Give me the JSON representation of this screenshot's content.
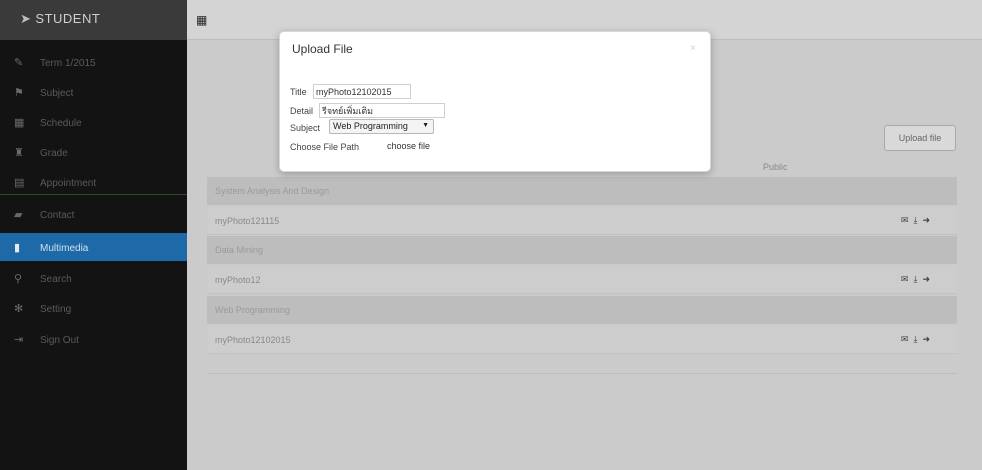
{
  "header": {
    "brand": "STUDENT",
    "brand_icon": "send-icon",
    "grid_icon": "grid-icon"
  },
  "sidebar": {
    "items": [
      {
        "label": "Term 1/2015",
        "icon": "edit-icon",
        "glyph": "✎"
      },
      {
        "label": "Subject",
        "icon": "flag-icon",
        "glyph": "⚑"
      },
      {
        "label": "Schedule",
        "icon": "calendar-icon",
        "glyph": "▦"
      },
      {
        "label": "Grade",
        "icon": "graduation-cap-icon",
        "glyph": "♜"
      },
      {
        "label": "Appointment",
        "icon": "list-icon",
        "glyph": "▤"
      },
      {
        "label": "Contact",
        "icon": "book-icon",
        "glyph": "▰"
      },
      {
        "label": "Multimedia",
        "icon": "file-icon",
        "glyph": "▮"
      },
      {
        "label": "Search",
        "icon": "search-icon",
        "glyph": "⚲"
      },
      {
        "label": "Setting",
        "icon": "gear-icon",
        "glyph": "✻"
      },
      {
        "label": "Sign Out",
        "icon": "sign-out-icon",
        "glyph": "⇥"
      }
    ],
    "active_index": 6,
    "active_color": "#1e6aa8"
  },
  "main": {
    "upload_button": "Upload file",
    "public_column": "Public",
    "rows": [
      {
        "type": "group",
        "label": "System Analysis And Design"
      },
      {
        "type": "item",
        "label": "myPhoto121115"
      },
      {
        "type": "group",
        "label": "Data Mining"
      },
      {
        "type": "item",
        "label": "myPhoto12"
      },
      {
        "type": "group",
        "label": "Web Programming"
      },
      {
        "type": "item",
        "label": "myPhoto12102015"
      }
    ],
    "row_action_icons": [
      "envelope-icon",
      "download-icon",
      "share-icon"
    ]
  },
  "modal": {
    "title": "Upload File",
    "close_label": "×",
    "title_label": "Title",
    "title_value": "myPhoto12102015",
    "detail_label": "Detail",
    "detail_value": "รีจทย์เพิ่มเติม",
    "subject_label": "Subject",
    "subject_value": "Web Programming",
    "file_path_label": "Choose File Path",
    "file_button": "choose file"
  }
}
